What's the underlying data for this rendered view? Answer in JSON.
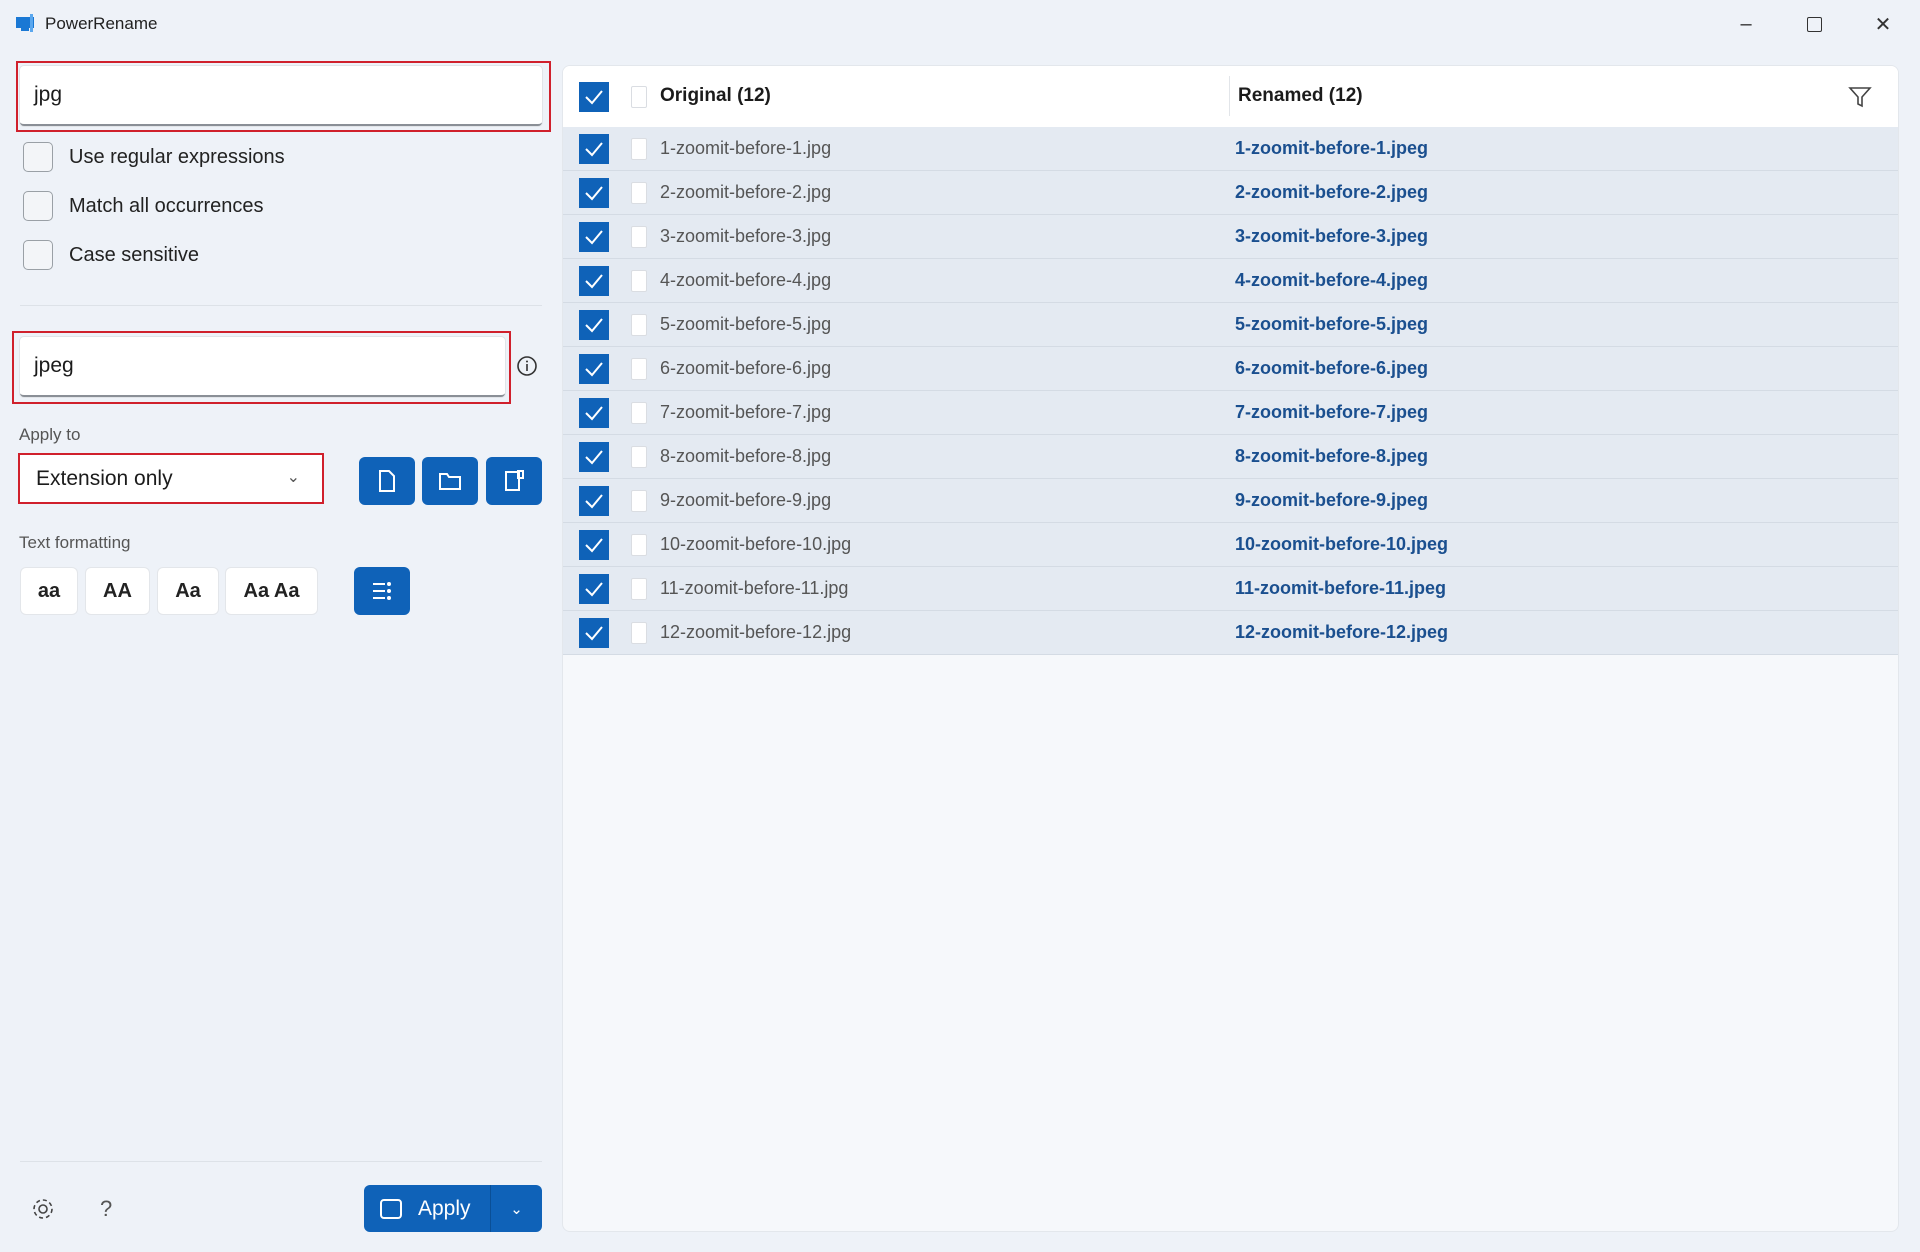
{
  "window": {
    "title": "PowerRename",
    "icon": "powerrename-app-icon",
    "controls": [
      "minimize-icon",
      "maximize-icon",
      "close-icon"
    ]
  },
  "search": {
    "value": "jpg"
  },
  "options": [
    {
      "label": "Use regular expressions",
      "checked": false
    },
    {
      "label": "Match all occurrences",
      "checked": false
    },
    {
      "label": "Case sensitive",
      "checked": false
    }
  ],
  "replace": {
    "value": "jpeg"
  },
  "apply_to": {
    "label": "Apply to",
    "selected": "Extension only",
    "buttons": [
      "file-icon",
      "folder-icon",
      "subfolder-icon"
    ]
  },
  "text_formatting": {
    "label": "Text formatting",
    "buttons": [
      "aa",
      "AA",
      "Aa",
      "Aa Aa"
    ]
  },
  "footer": {
    "apply_label": "Apply",
    "help": "?"
  },
  "colors": {
    "accent": "#0f62b8",
    "highlight": "#d0202c",
    "renamed_text": "#1a4f8f"
  },
  "table": {
    "original_header": "Original (12)",
    "renamed_header": "Renamed (12)",
    "rows": [
      {
        "original": "1-zoomit-before-1.jpg",
        "renamed": "1-zoomit-before-1.jpeg",
        "checked": true
      },
      {
        "original": "2-zoomit-before-2.jpg",
        "renamed": "2-zoomit-before-2.jpeg",
        "checked": true
      },
      {
        "original": "3-zoomit-before-3.jpg",
        "renamed": "3-zoomit-before-3.jpeg",
        "checked": true
      },
      {
        "original": "4-zoomit-before-4.jpg",
        "renamed": "4-zoomit-before-4.jpeg",
        "checked": true
      },
      {
        "original": "5-zoomit-before-5.jpg",
        "renamed": "5-zoomit-before-5.jpeg",
        "checked": true
      },
      {
        "original": "6-zoomit-before-6.jpg",
        "renamed": "6-zoomit-before-6.jpeg",
        "checked": true
      },
      {
        "original": "7-zoomit-before-7.jpg",
        "renamed": "7-zoomit-before-7.jpeg",
        "checked": true
      },
      {
        "original": "8-zoomit-before-8.jpg",
        "renamed": "8-zoomit-before-8.jpeg",
        "checked": true
      },
      {
        "original": "9-zoomit-before-9.jpg",
        "renamed": "9-zoomit-before-9.jpeg",
        "checked": true
      },
      {
        "original": "10-zoomit-before-10.jpg",
        "renamed": "10-zoomit-before-10.jpeg",
        "checked": true
      },
      {
        "original": "11-zoomit-before-11.jpg",
        "renamed": "11-zoomit-before-11.jpeg",
        "checked": true
      },
      {
        "original": "12-zoomit-before-12.jpg",
        "renamed": "12-zoomit-before-12.jpeg",
        "checked": true
      }
    ]
  }
}
